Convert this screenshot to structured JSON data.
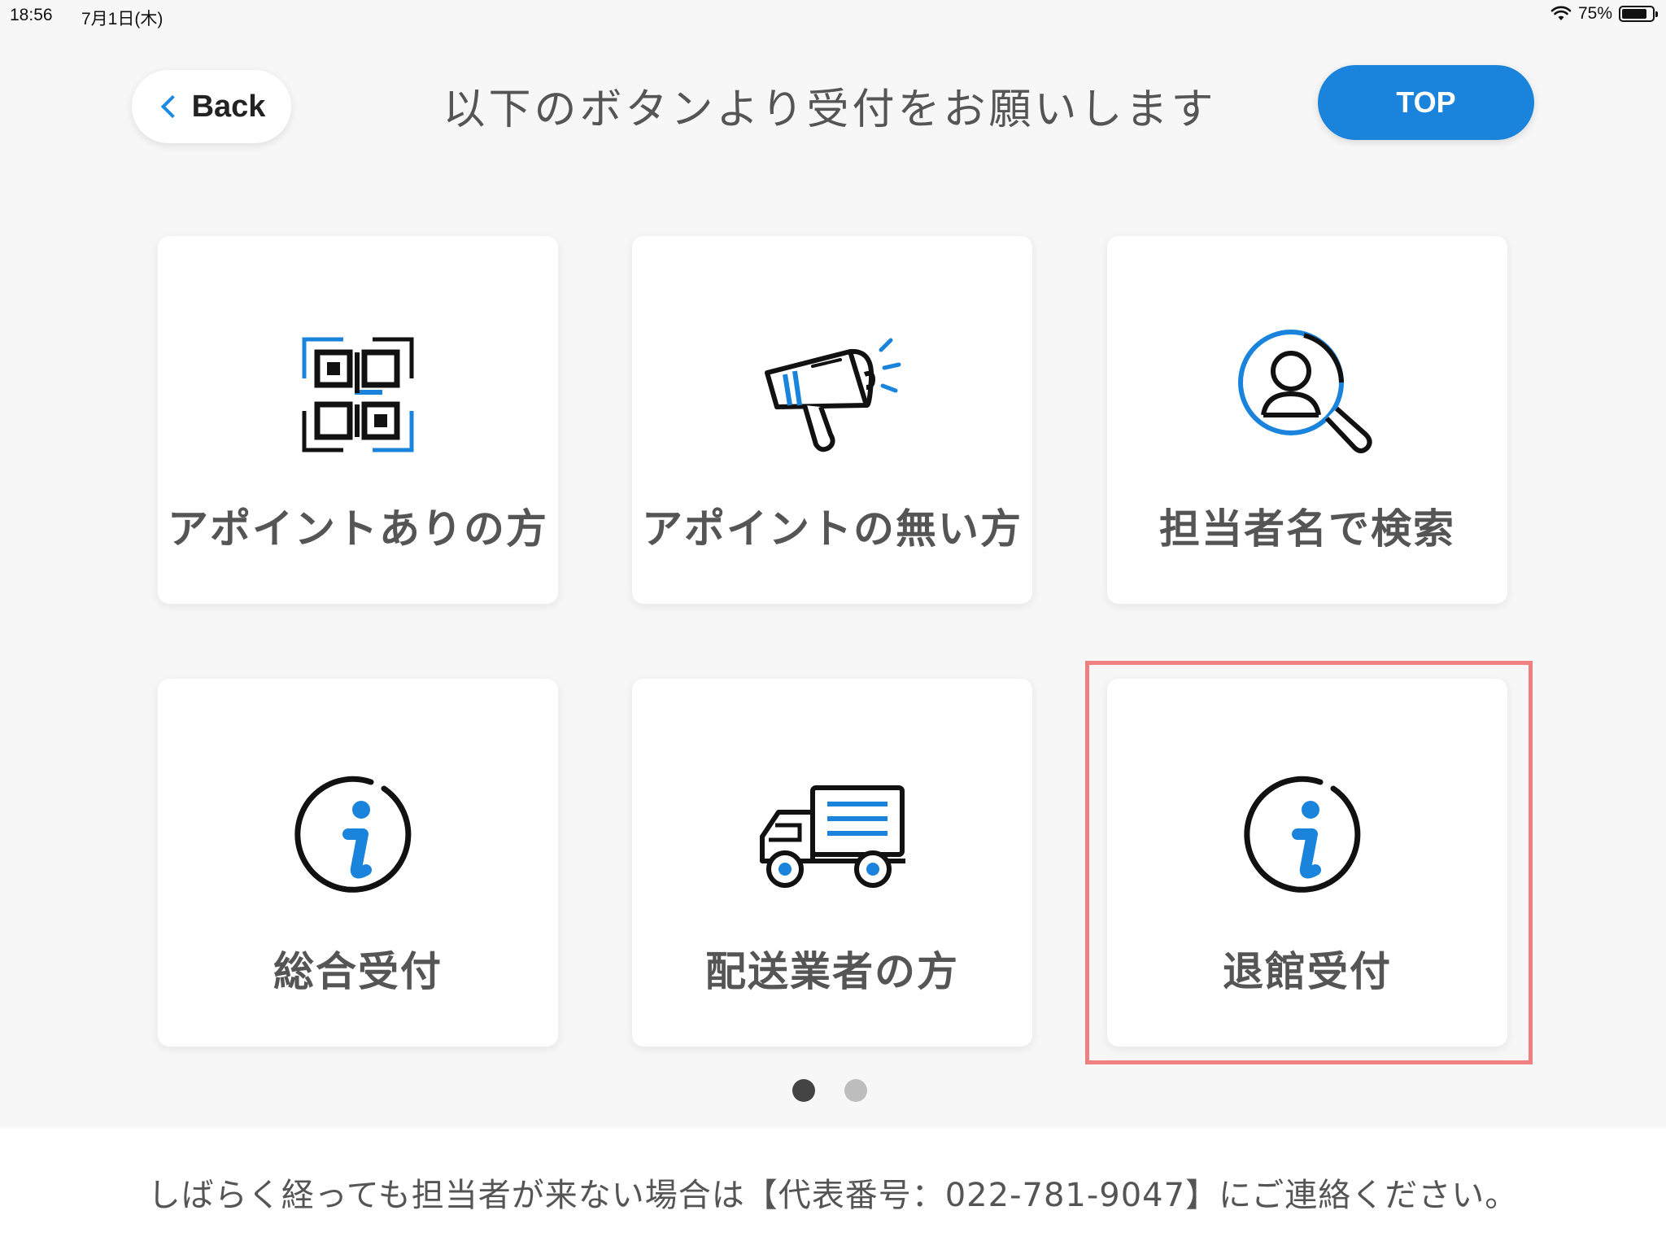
{
  "status_bar": {
    "time": "18:56",
    "date": "7月1日(木)",
    "battery": "75%",
    "battery_level": 0.75
  },
  "header": {
    "back_label": "Back",
    "title": "以下のボタンより受付をお願いします",
    "top_label": "TOP"
  },
  "cards": [
    {
      "label": "アポイントありの方",
      "icon": "qr-code-icon"
    },
    {
      "label": "アポイントの無い方",
      "icon": "megaphone-icon"
    },
    {
      "label": "担当者名で検索",
      "icon": "person-search-icon"
    },
    {
      "label": "総合受付",
      "icon": "info-icon"
    },
    {
      "label": "配送業者の方",
      "icon": "delivery-truck-icon"
    },
    {
      "label": "退館受付",
      "icon": "info-icon"
    }
  ],
  "pager": {
    "total_pages": 2,
    "current_page": 1
  },
  "footer": {
    "message": "しばらく経っても担当者が来ない場合は【代表番号：022-781-9047】にご連絡ください。"
  },
  "colors": {
    "accent": "#1a84dd",
    "highlight": "#f08080",
    "background": "#f7f7f7"
  }
}
